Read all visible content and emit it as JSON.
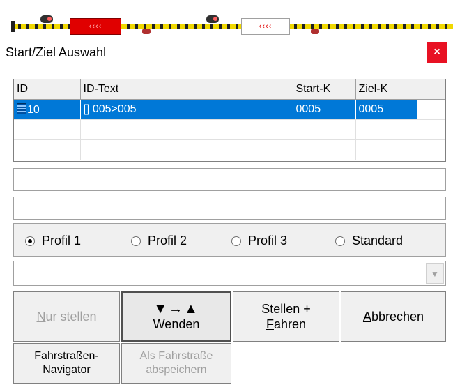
{
  "track": {
    "block_red_label": "‹‹‹‹",
    "block_white_label": "‹‹‹‹"
  },
  "dialog": {
    "title": "Start/Ziel Auswahl",
    "close_label": "×"
  },
  "grid": {
    "columns": [
      "ID",
      "ID-Text",
      "Start-K",
      "Ziel-K",
      ""
    ],
    "rows": [
      {
        "id": "10",
        "text": "[] 005>005",
        "start": "0005",
        "ziel": "0005",
        "selected": true
      }
    ]
  },
  "radios": [
    {
      "label": "Profil 1",
      "checked": true
    },
    {
      "label": "Profil 2",
      "checked": false
    },
    {
      "label": "Profil 3",
      "checked": false
    },
    {
      "label": "Standard",
      "checked": false
    }
  ],
  "combo": {
    "value": "",
    "arrow": "▼"
  },
  "buttons": {
    "nur_stellen": {
      "mnemonic": "N",
      "rest": "ur stellen",
      "enabled": false
    },
    "wenden": {
      "arrows": "▼→▲",
      "label": "Wenden",
      "pressed": true
    },
    "stellen_fahren": {
      "line1": "Stellen +",
      "mnemonic": "F",
      "rest": "ahren"
    },
    "abbrechen": {
      "mnemonic": "A",
      "rest": "bbrechen"
    },
    "navigator": {
      "line1": "Fahrstraßen-",
      "line2": "Navigator"
    },
    "speichern": {
      "line1": "Als Fahrstraße",
      "line2": "abspeichern",
      "enabled": false
    }
  },
  "colors": {
    "selection": "#0078d7",
    "close": "#e81123",
    "track_red": "#e00000",
    "track_yellow": "#f0d800"
  }
}
